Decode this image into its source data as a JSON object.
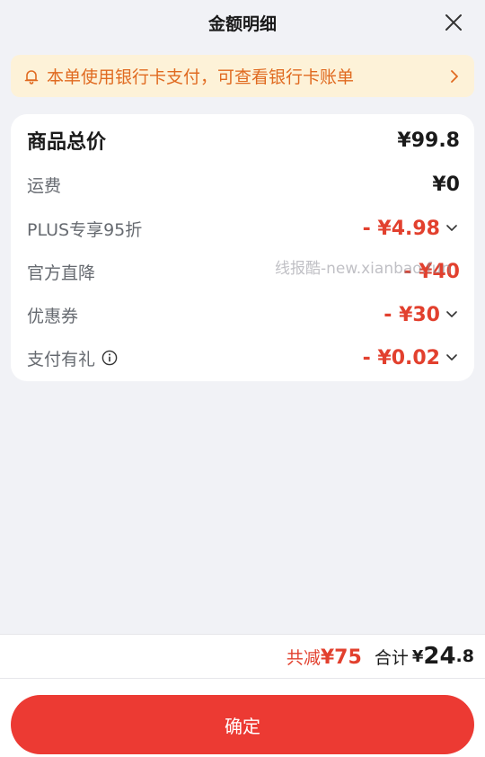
{
  "header": {
    "title": "金额明细",
    "close_icon": "close-icon"
  },
  "notice": {
    "text": "本单使用银行卡支付，可查看银行卡账单",
    "icon": "bell-icon",
    "arrow_icon": "chevron-right-icon"
  },
  "breakdown": {
    "total": {
      "label": "商品总价",
      "amount": "¥99.8"
    },
    "shipping": {
      "label": "运费",
      "amount": "¥0"
    },
    "plus": {
      "label": "PLUS专享95折",
      "amount": "- ¥4.98"
    },
    "direct": {
      "label": "官方直降",
      "amount": "- ¥40"
    },
    "coupon": {
      "label": "优惠券",
      "amount": "- ¥30"
    },
    "gift": {
      "label": "支付有礼",
      "amount": "- ¥0.02"
    }
  },
  "watermark": "线报酷-new.xianbao.fun",
  "footer": {
    "saved_prefix": "共减",
    "saved_amount": "¥75",
    "total_label": "合计",
    "currency": "¥",
    "total_int": "24",
    "total_dec": ".8"
  },
  "confirm_label": "确定",
  "colors": {
    "accent": "#ec3a33",
    "discount": "#e2402e",
    "notice_bg": "#fdf2d8",
    "notice_text": "#e06a20"
  }
}
